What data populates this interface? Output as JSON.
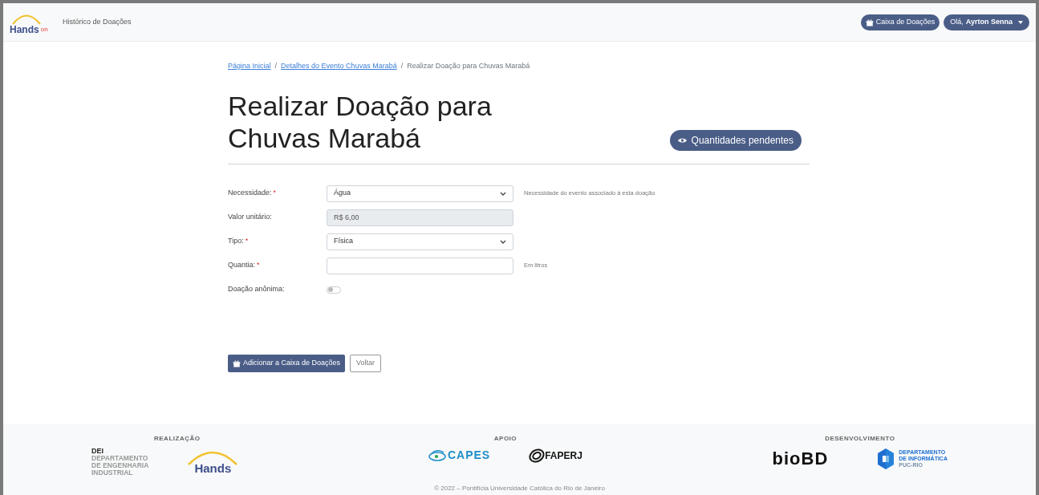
{
  "navbar": {
    "logo": {
      "text": "Hands",
      "suffix": "on"
    },
    "links": [
      "Histórico de Doações"
    ],
    "box_button": "Caixa de Doações",
    "user_menu": {
      "greeting": "Olá,",
      "name": "Ayrton Senna"
    }
  },
  "breadcrumb": {
    "separator": "/",
    "items": [
      {
        "label": "Página Inicial",
        "link": true
      },
      {
        "label": "Detalhes do Evento Chuvas Marabá",
        "link": true
      },
      {
        "label": "Realizar Doação para Chuvas Marabá",
        "link": false
      }
    ]
  },
  "required_mark": "*",
  "title": "Realizar Doação para Chuvas Marabá",
  "pending_button": "Quantidades pendentes",
  "fields": [
    {
      "kind": "select",
      "label": "Necessidade:",
      "required": true,
      "value": "Água",
      "help": "Necessidade do evento associado à esta doação"
    },
    {
      "kind": "readonly",
      "label": "Valor unitário:",
      "required": false,
      "value": "R$ 6,00"
    },
    {
      "kind": "select",
      "label": "Tipo:",
      "required": true,
      "value": "Física"
    },
    {
      "kind": "input",
      "label": "Quantia:",
      "required": true,
      "help": "Em litros"
    },
    {
      "kind": "toggle",
      "label": "Doação anônima:",
      "required": false,
      "on": false
    }
  ],
  "actions": {
    "primary": "Adicionar a Caixa de Doações",
    "secondary": "Voltar"
  },
  "footer": {
    "sections": [
      {
        "heading": "REALIZAÇÃO",
        "logos": [
          {
            "kind": "dei",
            "lines": [
              "DEI",
              "DEPARTAMENTO",
              "DE ENGENHARIA",
              "INDUSTRIAL"
            ]
          },
          {
            "kind": "hands",
            "lines": [
              "Hands"
            ]
          }
        ]
      },
      {
        "heading": "APOIO",
        "logos": [
          {
            "kind": "capes",
            "lines": [
              "CAPES"
            ]
          },
          {
            "kind": "faperj",
            "lines": [
              "FAPERJ"
            ]
          }
        ]
      },
      {
        "heading": "DESENVOLVIMENTO",
        "logos": [
          {
            "kind": "biobd",
            "lines": [
              "bioBD"
            ]
          },
          {
            "kind": "di",
            "lines": [
              "DEPARTAMENTO",
              "DE INFORMÁTICA",
              "PUC-RIO"
            ]
          }
        ]
      }
    ],
    "copyright": "© 2022 – Pontifícia Universidade Católica do Rio de Janeiro"
  }
}
